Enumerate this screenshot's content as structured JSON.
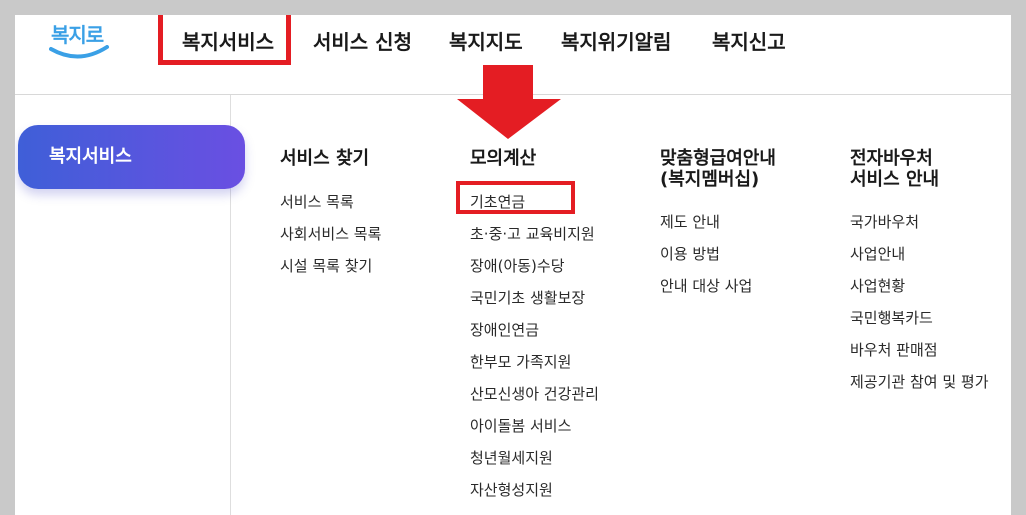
{
  "logo": {
    "text": "복지로"
  },
  "gnb": {
    "items": [
      "복지서비스",
      "서비스 신청",
      "복지지도",
      "복지위기알림",
      "복지신고"
    ]
  },
  "side": {
    "active_label": "복지서비스"
  },
  "menu": {
    "columns": [
      {
        "title": "서비스 찾기",
        "items": [
          "서비스 목록",
          "사회서비스 목록",
          "시설 목록 찾기"
        ]
      },
      {
        "title": "모의계산",
        "items": [
          "기초연금",
          "초·중·고 교육비지원",
          "장애(아동)수당",
          "국민기초 생활보장",
          "장애인연금",
          "한부모 가족지원",
          "산모신생아 건강관리",
          "아이돌봄 서비스",
          "청년월세지원",
          "자산형성지원"
        ]
      },
      {
        "title": "맞춤형급여안내\n(복지멤버십)",
        "items": [
          "제도 안내",
          "이용 방법",
          "안내 대상 사업"
        ]
      },
      {
        "title": "전자바우처\n서비스 안내",
        "items": [
          "국가바우처",
          "사업안내",
          "사업현황",
          "국민행복카드",
          "바우처 판매점",
          "제공기관 참여 및 평가"
        ]
      }
    ]
  },
  "colors": {
    "annotation_red": "#e41d23",
    "pill_start": "#3f5fd8",
    "pill_end": "#6a4fe2",
    "logo_blue": "#3aa0e6"
  },
  "icons": {
    "logo_smile": "smile-curve",
    "annotation_arrow": "down-arrow"
  }
}
